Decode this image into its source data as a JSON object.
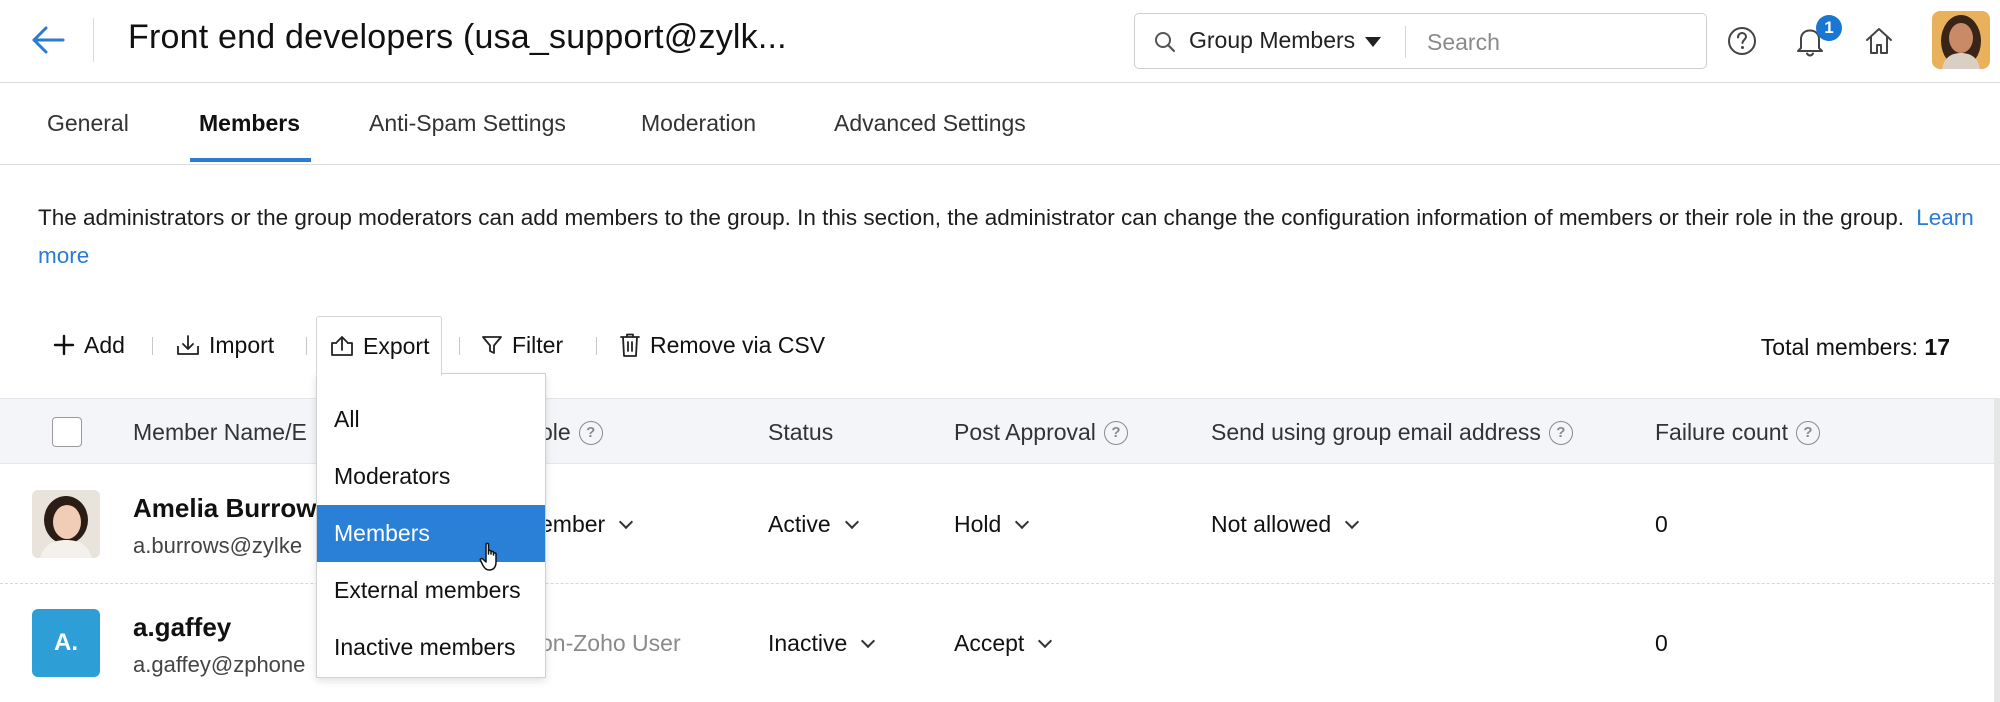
{
  "header": {
    "title": "Front end developers (usa_support@zylk...",
    "search_scope": "Group Members",
    "search_placeholder": "Search",
    "notification_count": "1"
  },
  "tabs": [
    {
      "label": "General",
      "active": false
    },
    {
      "label": "Members",
      "active": true
    },
    {
      "label": "Anti-Spam Settings",
      "active": false
    },
    {
      "label": "Moderation",
      "active": false
    },
    {
      "label": "Advanced Settings",
      "active": false
    }
  ],
  "description": {
    "text": "The administrators or the group moderators can add members to the group. In this section, the administrator can change the configuration information of members or their role in the group.",
    "link": "Learn more"
  },
  "toolbar": {
    "add": "Add",
    "import": "Import",
    "export": "Export",
    "filter": "Filter",
    "remove_csv": "Remove via CSV",
    "total_label": "Total members:",
    "total_value": "17"
  },
  "table": {
    "columns": {
      "member": "Member Name/E",
      "role": "ole",
      "status": "Status",
      "post_approval": "Post Approval",
      "send_group_email": "Send using group email address",
      "failure_count": "Failure count"
    },
    "rows": [
      {
        "name": "Amelia Burrow",
        "email": "a.burrows@zylke",
        "role": "ember",
        "status": "Active",
        "post_approval": "Hold",
        "send_group_email": "Not allowed",
        "failure_count": "0"
      },
      {
        "avatar_letter": "A.",
        "name": "a.gaffey",
        "email": "a.gaffey@zphone",
        "role": "on-Zoho User",
        "status": "Inactive",
        "post_approval": "Accept",
        "send_group_email": "",
        "failure_count": "0"
      }
    ]
  },
  "export_menu": {
    "items": [
      "All",
      "Moderators",
      "Members",
      "External members",
      "Inactive members"
    ],
    "selected": "Members"
  },
  "colors": {
    "accent": "#2a7bd4",
    "selected_item": "#2a80d6",
    "badge": "#1976d2",
    "letter_avatar": "#2d9fd6",
    "header_row": "#f3f5f8"
  },
  "icons": {
    "back": "arrow-left-icon",
    "search": "search-icon",
    "help": "help-circle-icon",
    "notifications": "bell-icon",
    "home": "home-icon",
    "add": "plus-icon",
    "import": "import-icon",
    "export": "export-icon",
    "filter": "filter-icon",
    "remove_csv": "trash-icon"
  }
}
